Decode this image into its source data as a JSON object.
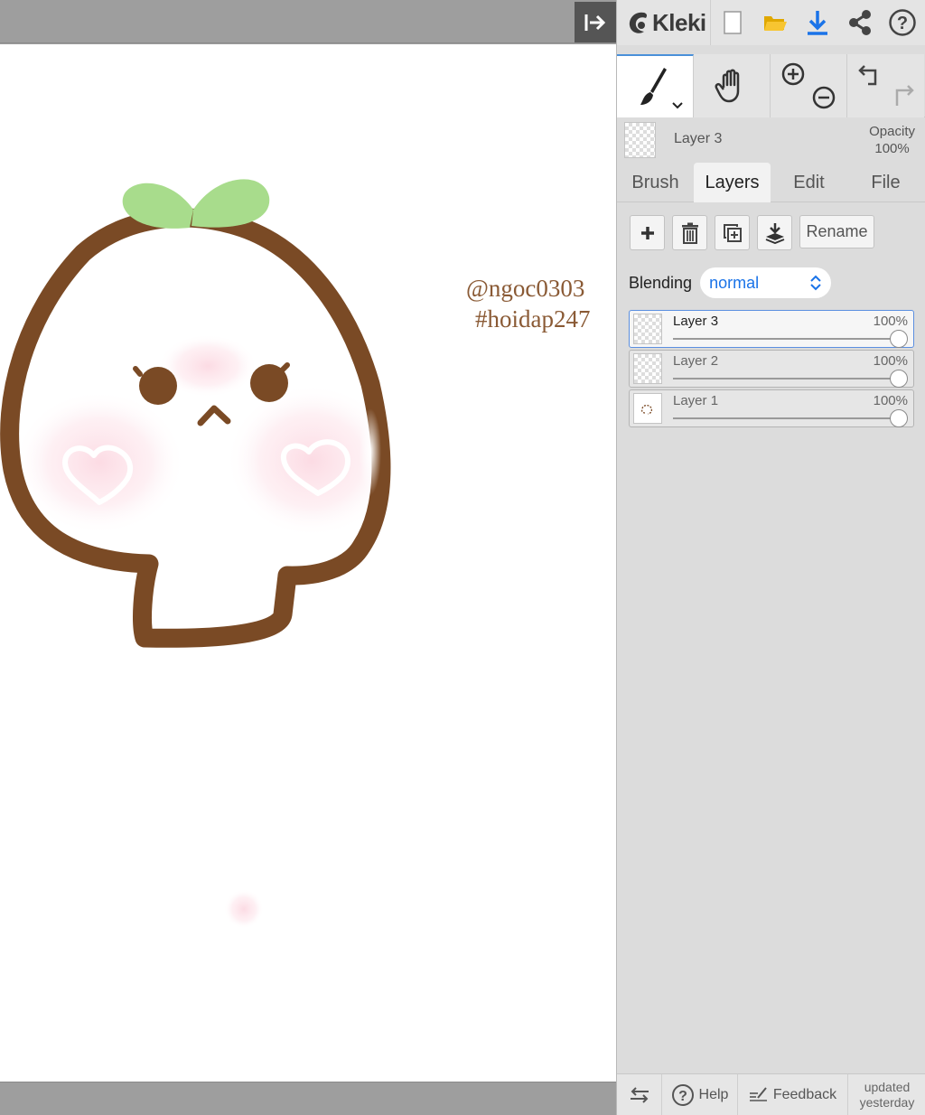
{
  "app": {
    "logo_text": "Kleki"
  },
  "canvas": {
    "watermark_line1": "@ngoc0303",
    "watermark_line2": "#hoidap247"
  },
  "toolbar": {
    "icons": [
      "new-image-icon",
      "open-folder-icon",
      "download-icon",
      "share-icon",
      "help-icon"
    ],
    "download_color": "#1a73e8"
  },
  "tools": {
    "icons": [
      "brush-icon",
      "hand-icon",
      "zoom-icon",
      "undo-redo-icon"
    ]
  },
  "current_layer": {
    "name": "Layer 3",
    "opacity_label": "Opacity",
    "opacity_value": "100%"
  },
  "tabs": [
    "Brush",
    "Layers",
    "Edit",
    "File"
  ],
  "active_tab": "Layers",
  "layer_actions": {
    "rename_label": "Rename"
  },
  "blending": {
    "label": "Blending",
    "value": "normal"
  },
  "layers": [
    {
      "name": "Layer 3",
      "opacity": "100%",
      "selected": true
    },
    {
      "name": "Layer 2",
      "opacity": "100%",
      "selected": false
    },
    {
      "name": "Layer 1",
      "opacity": "100%",
      "selected": false
    }
  ],
  "bottom_bar": {
    "help_label": "Help",
    "feedback_label": "Feedback",
    "updated_line1": "updated",
    "updated_line2": "yesterday"
  },
  "colors": {
    "accent": "#1a73e8",
    "outline_brown": "#7a4a25",
    "sprout_green": "#a8dc8c",
    "blush_pink": "#fde4ea"
  }
}
